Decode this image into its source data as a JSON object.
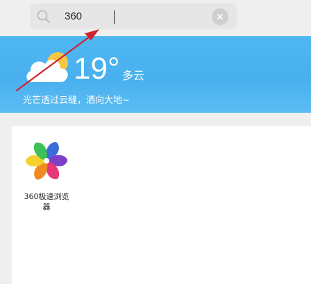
{
  "search": {
    "value": "360",
    "icon": "search-icon",
    "clear_icon": "clear-icon"
  },
  "weather": {
    "temperature": "19°",
    "condition": "多云",
    "tagline": "光芒透过云缝，洒向大地~",
    "icon": "partly-cloudy-icon"
  },
  "apps": [
    {
      "label": "360极速浏览器",
      "icon": "pinwheel-icon"
    }
  ],
  "colors": {
    "banner": "#4fb7f1",
    "arrow": "#d0242b",
    "search_bg": "#e6e6e6"
  }
}
